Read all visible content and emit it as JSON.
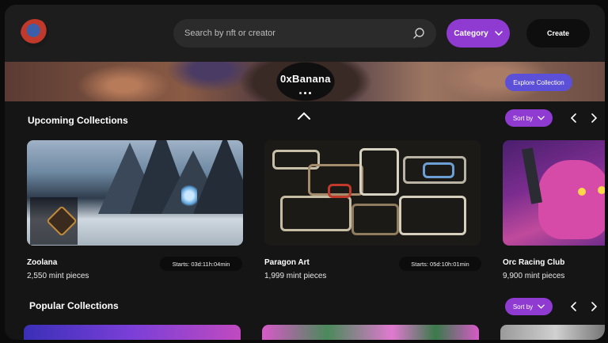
{
  "header": {
    "search_placeholder": "Search by nft or creator",
    "category_label": "Category",
    "create_label": "Create"
  },
  "banner": {
    "title": "0xBanana",
    "explore_label": "Explore Collection",
    "slides": 3,
    "active_slide": 2
  },
  "upcoming": {
    "title": "Upcoming Collections",
    "sort_label": "Sort by",
    "cards": [
      {
        "name": "Zoolana",
        "pieces": "2,550 mint pieces",
        "starts": "Starts: 03d:11h:04min"
      },
      {
        "name": "Paragon Art",
        "pieces": "1,999 mint pieces",
        "starts": "Starts: 05d:10h:01min"
      },
      {
        "name": "Orc Racing Club",
        "pieces": "9,900 mint pieces",
        "starts": ""
      }
    ]
  },
  "popular": {
    "title": "Popular Collections",
    "sort_label": "Sort by"
  },
  "colors": {
    "accent_purple": "#8f3bd1",
    "explore_blue": "#5c4fd8",
    "background": "#151515"
  },
  "icons": [
    "search-icon",
    "chevron-down-icon",
    "chevron-up-icon",
    "chevron-left-icon",
    "chevron-right-icon"
  ]
}
